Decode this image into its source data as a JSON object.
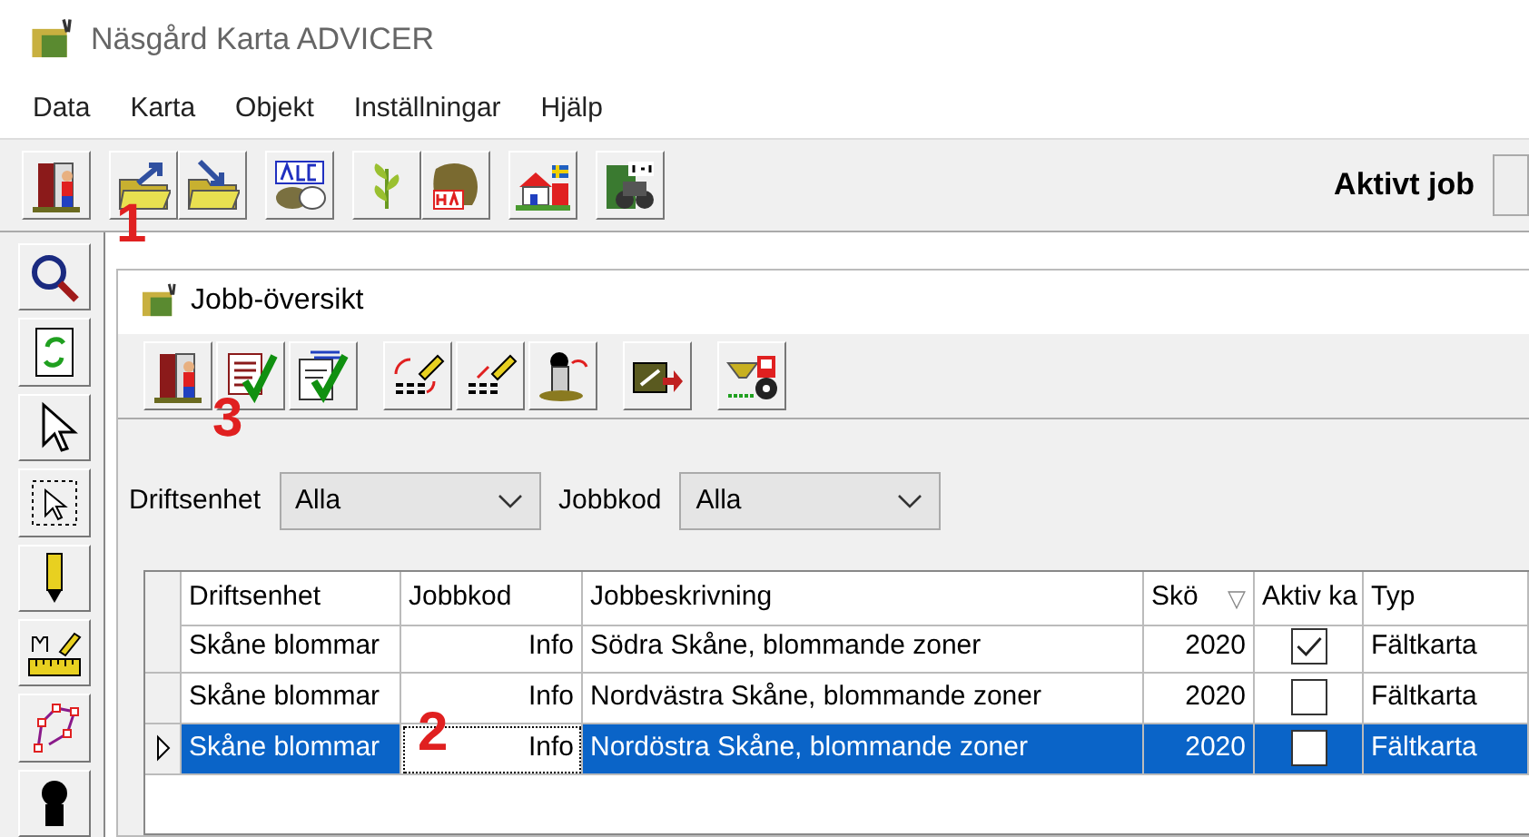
{
  "window": {
    "title": "Näsgård Karta ADVICER"
  },
  "menu": [
    "Data",
    "Karta",
    "Objekt",
    "Inställningar",
    "Hjälp"
  ],
  "active_job": {
    "label": "Aktivt job"
  },
  "child_window": {
    "title": "Jobb-översikt"
  },
  "filters": [
    {
      "label": "Driftsenhet",
      "value": "Alla"
    },
    {
      "label": "Jobbkod",
      "value": "Alla"
    }
  ],
  "table": {
    "columns": [
      {
        "label": "Driftsenhet"
      },
      {
        "label": "Jobbkod"
      },
      {
        "label": "Jobbeskrivning"
      },
      {
        "label": "Skö",
        "sort": "▽"
      },
      {
        "label": "Aktiv ka"
      },
      {
        "label": "Typ"
      }
    ],
    "rows": [
      {
        "selected": false,
        "driftsenhet": "Skåne blommar",
        "jobbkod": "Info",
        "jobbeskrivning": "Södra Skåne, blommande zoner",
        "year": "2020",
        "checked": true,
        "typ": "Fältkarta"
      },
      {
        "selected": false,
        "driftsenhet": "Skåne blommar",
        "jobbkod": "Info",
        "jobbeskrivning": "Nordvästra Skåne, blommande zoner",
        "year": "2020",
        "checked": false,
        "typ": "Fältkarta"
      },
      {
        "selected": true,
        "driftsenhet": "Skåne blommar",
        "jobbkod": "Info",
        "jobbeskrivning": "Nordöstra Skåne, blommande zoner",
        "year": "2020",
        "checked": false,
        "typ": "Fältkarta"
      }
    ]
  },
  "annotations": [
    {
      "text": "1"
    },
    {
      "text": "3"
    },
    {
      "text": "2"
    }
  ]
}
